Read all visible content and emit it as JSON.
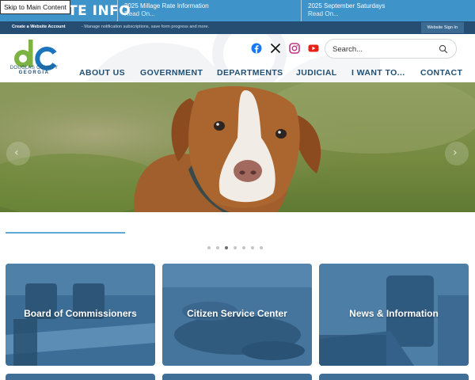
{
  "skip_link": "Skip to Main Content",
  "ticker": {
    "title": "TE INFO",
    "items": [
      {
        "title": "2025 Millage Rate Information",
        "read": "Read On..."
      },
      {
        "title": "2025 September Saturdays",
        "read": "Read On..."
      }
    ]
  },
  "account_bar": {
    "create": "Create a Website Account",
    "description": "- Manage notification subscriptions, save form progress and more.",
    "sign_in": "Website Sign In"
  },
  "logo": {
    "letters": "dc",
    "county": "DOUGLAS COUNTY",
    "state": "GEORGIA"
  },
  "social": [
    "facebook-icon",
    "x-icon",
    "instagram-icon",
    "youtube-icon"
  ],
  "search": {
    "placeholder": "Search..."
  },
  "nav": [
    "ABOUT US",
    "GOVERNMENT",
    "DEPARTMENTS",
    "JUDICIAL",
    "I WANT TO...",
    "CONTACT"
  ],
  "hero": {
    "prev": "‹",
    "next": "›"
  },
  "slider": {
    "count": 7,
    "active_index": 2
  },
  "tiles": [
    "Board of Commissioners",
    "Citizen Service Center",
    "News & Information"
  ],
  "colors": {
    "ticker": "#3e93c9",
    "account_bar": "#264e73",
    "nav_text": "#1f4e72",
    "logo_green": "#7cb342",
    "logo_blue": "#1c75bc"
  }
}
